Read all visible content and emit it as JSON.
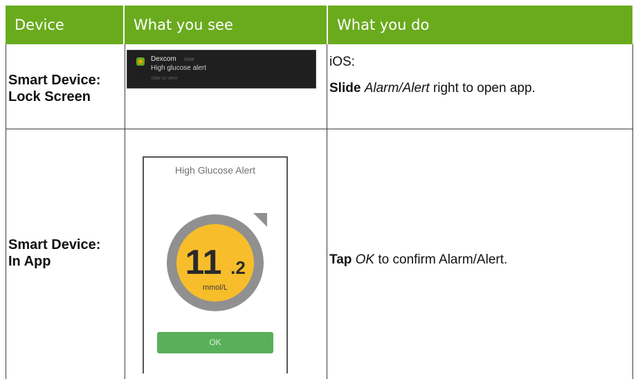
{
  "header": {
    "device": "Device",
    "what_you_see": "What you see",
    "what_you_do": "What you do"
  },
  "rows": [
    {
      "device_line1": "Smart Device:",
      "device_line2": "Lock Screen",
      "notification": {
        "app": "Dexcom",
        "time": "now",
        "message": "High glucose alert",
        "subtext": "slide to view"
      },
      "action_platform": "iOS:",
      "action_verb": "Slide",
      "action_object": "Alarm/Alert",
      "action_rest": "right to open app."
    },
    {
      "device_line1": "Smart Device:",
      "device_line2": "In App",
      "screen": {
        "title": "High Glucose Alert",
        "value_major": "11",
        "value_minor": ".2",
        "unit": "mmol/L",
        "button": "OK"
      },
      "action_verb": "Tap",
      "action_object": "OK",
      "action_rest": "to confirm Alarm/Alert."
    }
  ],
  "colors": {
    "header_green": "#6aab1e",
    "gauge_yellow": "#f7bd2b",
    "gauge_ring": "#909090",
    "ok_green": "#5ab05a"
  }
}
